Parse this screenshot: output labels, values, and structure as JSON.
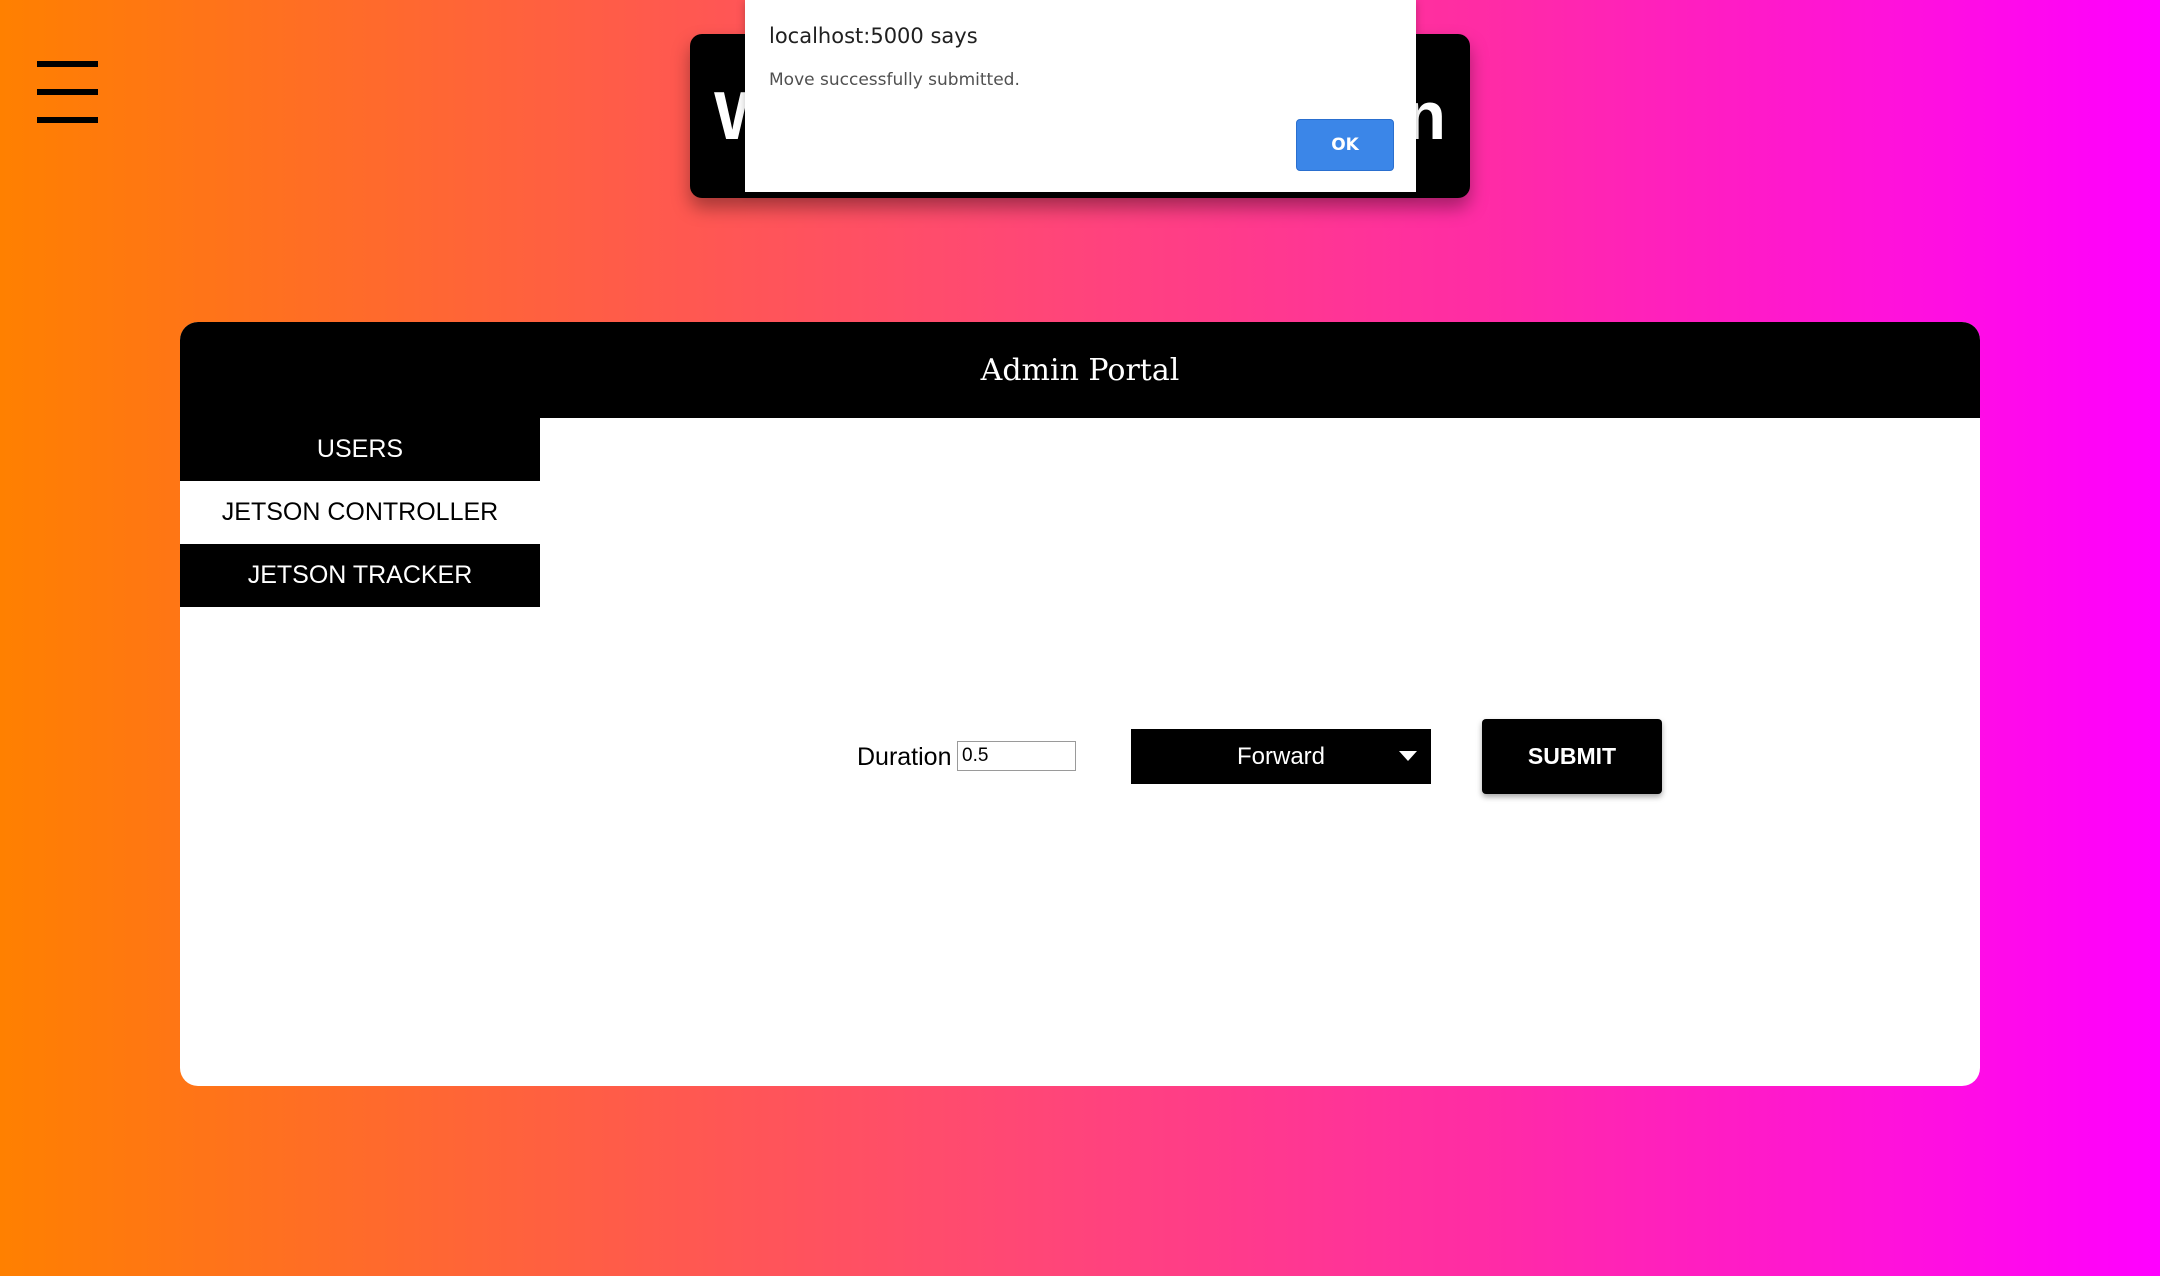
{
  "menu": {
    "icon": "hamburger-menu-icon"
  },
  "banner": {
    "title_left": "W",
    "title_right": "n"
  },
  "alert": {
    "title": "localhost:5000 says",
    "message": "Move successfully submitted.",
    "ok_label": "OK",
    "ok_color": "#3b86e8"
  },
  "portal": {
    "title": "Admin Portal",
    "nav": [
      {
        "label": "USERS",
        "active": false
      },
      {
        "label": "JETSON CONTROLLER",
        "active": true
      },
      {
        "label": "JETSON TRACKER",
        "active": false
      }
    ]
  },
  "form": {
    "duration_label": "Duration",
    "duration_value": "0.5",
    "direction_selected": "Forward",
    "submit_label": "SUBMIT"
  },
  "colors": {
    "gradient_start": "#ff8000",
    "gradient_end": "#ff00ff",
    "panel_black": "#000000"
  }
}
